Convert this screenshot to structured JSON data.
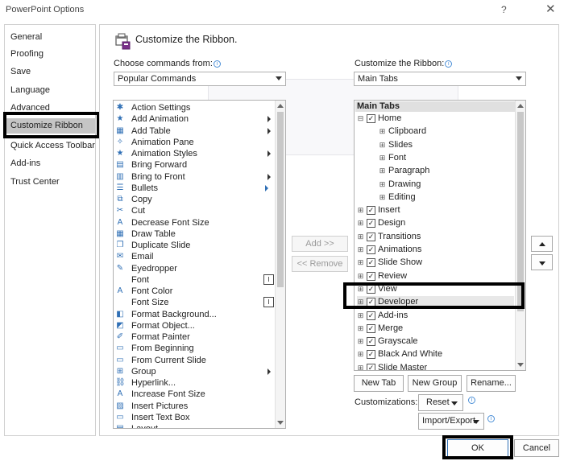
{
  "window": {
    "title": "PowerPoint Options",
    "help": "?",
    "close": "✕"
  },
  "nav": {
    "items": [
      {
        "label": "General"
      },
      {
        "label": "Proofing"
      },
      {
        "label": "Save"
      },
      {
        "label": "Language"
      },
      {
        "label": "Advanced"
      },
      {
        "label": "Customize Ribbon",
        "selected": true
      },
      {
        "label": "Quick Access Toolbar"
      },
      {
        "label": "Add-ins"
      },
      {
        "label": "Trust Center"
      }
    ]
  },
  "main": {
    "heading": "Customize the Ribbon.",
    "choose_label": "Choose commands from:",
    "choose_value": "Popular Commands",
    "customize_label": "Customize the Ribbon:",
    "customize_value": "Main Tabs",
    "commands": [
      {
        "label": "Action Settings",
        "icon": "action-settings-icon",
        "glyph": "✱"
      },
      {
        "label": "Add Animation",
        "icon": "star-icon",
        "glyph": "★",
        "submenu": true
      },
      {
        "label": "Add Table",
        "icon": "table-icon",
        "glyph": "▦",
        "submenu": true
      },
      {
        "label": "Animation Pane",
        "icon": "animation-pane-icon",
        "glyph": "✧"
      },
      {
        "label": "Animation Styles",
        "icon": "star-icon",
        "glyph": "★",
        "submenu": true
      },
      {
        "label": "Bring Forward",
        "icon": "bring-forward-icon",
        "glyph": "▤"
      },
      {
        "label": "Bring to Front",
        "icon": "bring-to-front-icon",
        "glyph": "▥",
        "submenu": true
      },
      {
        "label": "Bullets",
        "icon": "bullets-icon",
        "glyph": "☰",
        "submenu_right": true
      },
      {
        "label": "Copy",
        "icon": "copy-icon",
        "glyph": "⧉"
      },
      {
        "label": "Cut",
        "icon": "scissors-icon",
        "glyph": "✂"
      },
      {
        "label": "Decrease Font Size",
        "icon": "decrease-font-icon",
        "glyph": "A"
      },
      {
        "label": "Draw Table",
        "icon": "draw-table-icon",
        "glyph": "▦"
      },
      {
        "label": "Duplicate Slide",
        "icon": "duplicate-slide-icon",
        "glyph": "❐"
      },
      {
        "label": "Email",
        "icon": "email-icon",
        "glyph": "✉"
      },
      {
        "label": "Eyedropper",
        "icon": "eyedropper-icon",
        "glyph": "✎"
      },
      {
        "label": "Font",
        "icon": "",
        "glyph": "",
        "textbox": true
      },
      {
        "label": "Font Color",
        "icon": "font-color-icon",
        "glyph": "A"
      },
      {
        "label": "Font Size",
        "icon": "",
        "glyph": "",
        "textbox": true
      },
      {
        "label": "Format Background...",
        "icon": "format-background-icon",
        "glyph": "◧"
      },
      {
        "label": "Format Object...",
        "icon": "format-object-icon",
        "glyph": "◩"
      },
      {
        "label": "Format Painter",
        "icon": "format-painter-icon",
        "glyph": "✐"
      },
      {
        "label": "From Beginning",
        "icon": "from-beginning-icon",
        "glyph": "▭"
      },
      {
        "label": "From Current Slide",
        "icon": "from-current-slide-icon",
        "glyph": "▭"
      },
      {
        "label": "Group",
        "icon": "group-icon",
        "glyph": "⊞",
        "submenu": true
      },
      {
        "label": "Hyperlink...",
        "icon": "hyperlink-icon",
        "glyph": "⛓"
      },
      {
        "label": "Increase Font Size",
        "icon": "increase-font-icon",
        "glyph": "A"
      },
      {
        "label": "Insert Pictures",
        "icon": "insert-pictures-icon",
        "glyph": "▨"
      },
      {
        "label": "Insert Text Box",
        "icon": "text-box-icon",
        "glyph": "▭"
      },
      {
        "label": "Layout",
        "icon": "layout-icon",
        "glyph": "▤"
      }
    ],
    "add_button": "Add >>",
    "remove_button": "<< Remove",
    "tree_header": "Main Tabs",
    "tree": [
      {
        "label": "Home",
        "level": 0,
        "exp": "⊟",
        "cb": true
      },
      {
        "label": "Clipboard",
        "level": 1,
        "exp": "⊞",
        "cb": false
      },
      {
        "label": "Slides",
        "level": 1,
        "exp": "⊞",
        "cb": false
      },
      {
        "label": "Font",
        "level": 1,
        "exp": "⊞",
        "cb": false
      },
      {
        "label": "Paragraph",
        "level": 1,
        "exp": "⊞",
        "cb": false
      },
      {
        "label": "Drawing",
        "level": 1,
        "exp": "⊞",
        "cb": false
      },
      {
        "label": "Editing",
        "level": 1,
        "exp": "⊞",
        "cb": false
      },
      {
        "label": "Insert",
        "level": 0,
        "exp": "⊞",
        "cb": true
      },
      {
        "label": "Design",
        "level": 0,
        "exp": "⊞",
        "cb": true
      },
      {
        "label": "Transitions",
        "level": 0,
        "exp": "⊞",
        "cb": true
      },
      {
        "label": "Animations",
        "level": 0,
        "exp": "⊞",
        "cb": true
      },
      {
        "label": "Slide Show",
        "level": 0,
        "exp": "⊞",
        "cb": true
      },
      {
        "label": "Review",
        "level": 0,
        "exp": "⊞",
        "cb": true
      },
      {
        "label": "View",
        "level": 0,
        "exp": "⊞",
        "cb": true
      },
      {
        "label": "Developer",
        "level": 0,
        "exp": "⊞",
        "cb": true,
        "selected": true
      },
      {
        "label": "Add-ins",
        "level": 0,
        "exp": "⊞",
        "cb": true
      },
      {
        "label": "Merge",
        "level": 0,
        "exp": "⊞",
        "cb": true
      },
      {
        "label": "Grayscale",
        "level": 0,
        "exp": "⊞",
        "cb": true
      },
      {
        "label": "Black And White",
        "level": 0,
        "exp": "⊞",
        "cb": true
      },
      {
        "label": "Slide Master",
        "level": 0,
        "exp": "⊞",
        "cb": true
      }
    ],
    "new_tab": "New Tab",
    "new_group": "New Group",
    "rename": "Rename...",
    "customizations_label": "Customizations:",
    "reset": "Reset",
    "import_export": "Import/Export"
  },
  "footer": {
    "ok": "OK",
    "cancel": "Cancel"
  }
}
